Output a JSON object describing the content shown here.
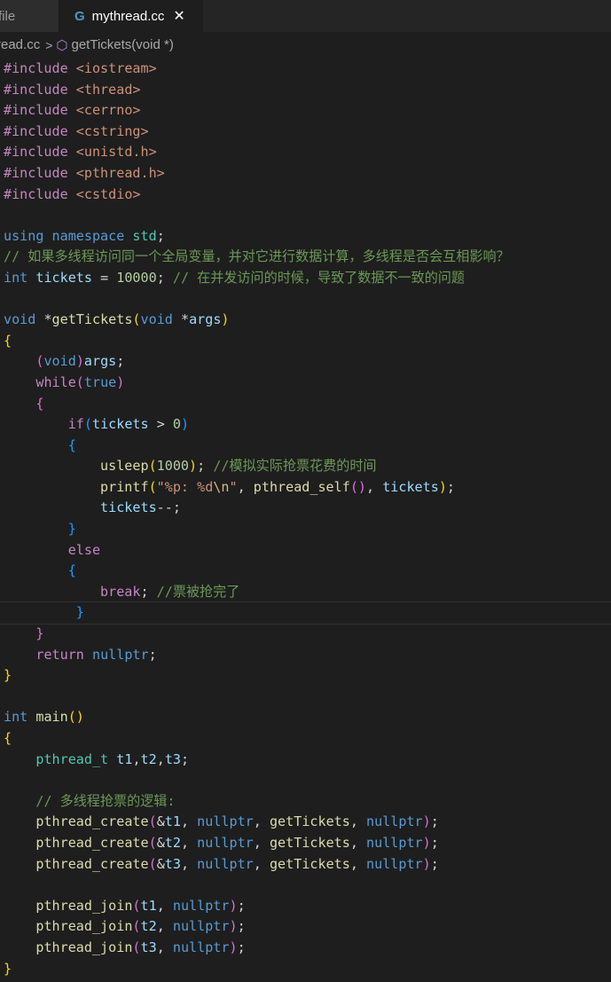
{
  "tabs": {
    "inactive_label": "file",
    "active_label": "mythread.cc"
  },
  "breadcrumb": {
    "file": "read.cc",
    "symbol": "getTickets(void *)"
  },
  "code": {
    "include_1": "<iostream>",
    "include_2": "<thread>",
    "include_3": "<cerrno>",
    "include_4": "<cstring>",
    "include_5": "<unistd.h>",
    "include_6": "<pthread.h>",
    "include_7": "<cstdio>",
    "comment_global": "// 如果多线程访问同一个全局变量，并对它进行数据计算，多线程是否会互相影响？",
    "tickets_init": "10000",
    "comment_tickets": "// 在并发访问的时候，导致了数据不一致的问题",
    "usleep_arg": "1000",
    "comment_usleep": "//模拟实际抢票花费的时间",
    "printf_fmt_1": "\"%p: %d",
    "printf_fmt_esc": "\\n",
    "printf_fmt_2": "\"",
    "comment_break": "//票被抢完了",
    "comment_logic": "// 多线程抢票的逻辑:"
  }
}
